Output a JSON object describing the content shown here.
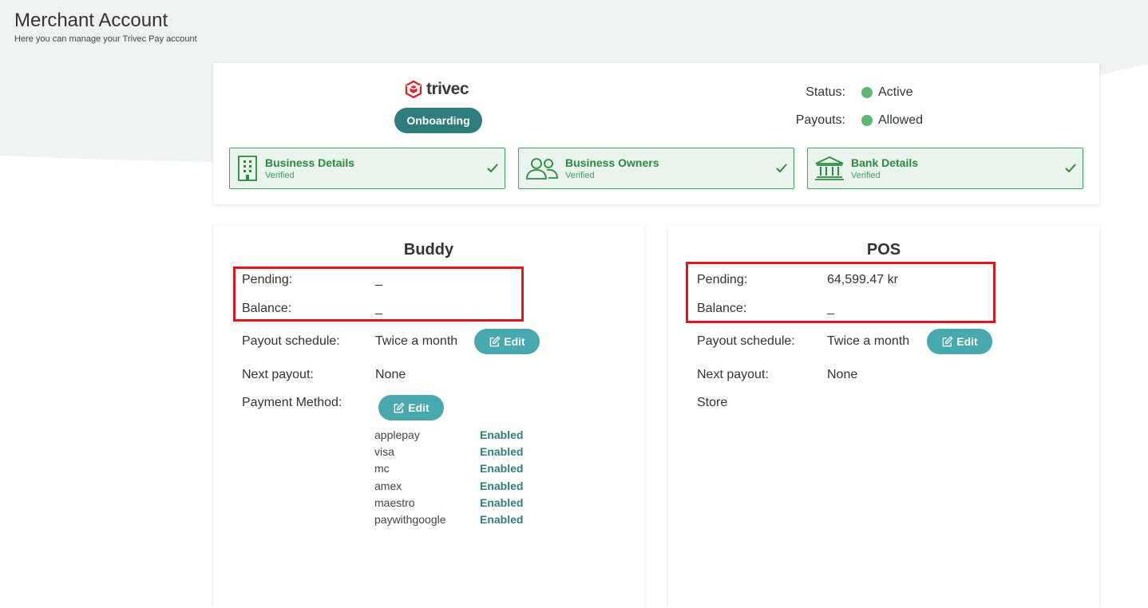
{
  "header": {
    "title": "Merchant Account",
    "subtitle": "Here you can manage your Trivec Pay account"
  },
  "account": {
    "brand": "trivec",
    "onboarding_label": "Onboarding",
    "status_label": "Status:",
    "status_value": "Active",
    "payouts_label": "Payouts:",
    "payouts_value": "Allowed",
    "status_color": "#5bb974",
    "verifications": [
      {
        "title": "Business Details",
        "status": "Verified",
        "icon": "building-icon"
      },
      {
        "title": "Business Owners",
        "status": "Verified",
        "icon": "users-icon"
      },
      {
        "title": "Bank Details",
        "status": "Verified",
        "icon": "bank-icon"
      }
    ]
  },
  "buddy": {
    "title": "Buddy",
    "pending_label": "Pending:",
    "pending_value": "_",
    "balance_label": "Balance:",
    "balance_value": "_",
    "schedule_label": "Payout schedule:",
    "schedule_value": "Twice a month",
    "edit_label": "Edit",
    "next_payout_label": "Next payout:",
    "next_payout_value": "None",
    "payment_method_label": "Payment Method:",
    "payment_edit_label": "Edit",
    "payment_methods": [
      {
        "name": "applepay",
        "status": "Enabled"
      },
      {
        "name": "visa",
        "status": "Enabled"
      },
      {
        "name": "mc",
        "status": "Enabled"
      },
      {
        "name": "amex",
        "status": "Enabled"
      },
      {
        "name": "maestro",
        "status": "Enabled"
      },
      {
        "name": "paywithgoogle",
        "status": "Enabled"
      }
    ]
  },
  "pos": {
    "title": "POS",
    "pending_label": "Pending:",
    "pending_value": "64,599.47 kr",
    "balance_label": "Balance:",
    "balance_value": "_",
    "schedule_label": "Payout schedule:",
    "schedule_value": "Twice a month",
    "edit_label": "Edit",
    "next_payout_label": "Next payout:",
    "next_payout_value": "None",
    "store_label": "Store"
  },
  "colors": {
    "accent": "#2e7c7c",
    "edit_button": "#47a8ad",
    "verified_green": "#2a8a3e",
    "highlight_red": "#e0161c"
  }
}
